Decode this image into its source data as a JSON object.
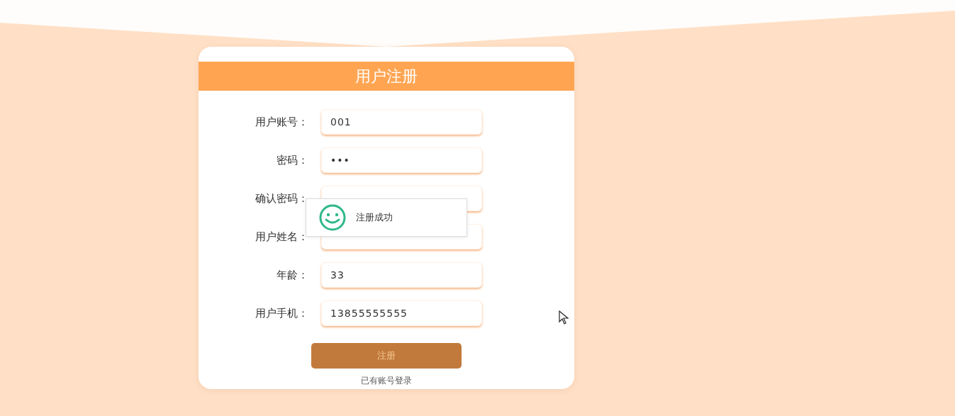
{
  "title": "用户注册",
  "fields": [
    {
      "label": "用户账号：",
      "value": "001"
    },
    {
      "label": "密码：",
      "value": "•••"
    },
    {
      "label": "确认密码："
    },
    {
      "label": "用户姓名："
    },
    {
      "label": "年龄：",
      "value": "33"
    },
    {
      "label": "用户手机：",
      "value": "13855555555"
    }
  ],
  "submit": "注册",
  "login_link": "已有账号登录",
  "toast": {
    "message": "注册成功"
  }
}
